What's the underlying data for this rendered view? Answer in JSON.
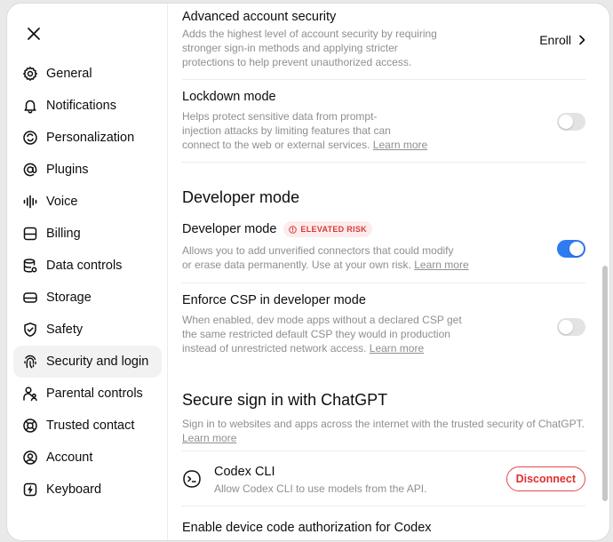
{
  "sidebar": {
    "items": [
      {
        "label": "General",
        "icon": "gear-icon"
      },
      {
        "label": "Notifications",
        "icon": "bell-icon"
      },
      {
        "label": "Personalization",
        "icon": "personalization-icon"
      },
      {
        "label": "Plugins",
        "icon": "at-icon"
      },
      {
        "label": "Voice",
        "icon": "waveform-icon"
      },
      {
        "label": "Billing",
        "icon": "billing-icon"
      },
      {
        "label": "Data controls",
        "icon": "database-icon"
      },
      {
        "label": "Storage",
        "icon": "storage-icon"
      },
      {
        "label": "Safety",
        "icon": "shield-icon"
      },
      {
        "label": "Security and login",
        "icon": "fingerprint-icon"
      },
      {
        "label": "Parental controls",
        "icon": "parental-icon"
      },
      {
        "label": "Trusted contact",
        "icon": "lifebuoy-icon"
      },
      {
        "label": "Account",
        "icon": "account-icon"
      },
      {
        "label": "Keyboard",
        "icon": "keyboard-icon"
      }
    ],
    "active": "Security and login"
  },
  "security": {
    "advanced": {
      "title": "Advanced account security",
      "desc_1": "Adds the highest level of account security by requiring",
      "desc_2": "stronger sign-in methods and applying stricter",
      "desc_3": "protections to help prevent unauthorized access.",
      "action": "Enroll"
    },
    "lockdown": {
      "title": "Lockdown mode",
      "desc_1": "Helps protect sensitive data from prompt-",
      "desc_2": "injection attacks by limiting features that can",
      "desc_3": "connect to the web or external services.",
      "link": "Learn more",
      "enabled": false
    }
  },
  "developer": {
    "section_title": "Developer mode",
    "mode": {
      "title": "Developer mode",
      "badge": "ELEVATED RISK",
      "desc_1": "Allows you to add unverified connectors that could modify",
      "desc_2": "or erase data permanently. Use at your own risk.",
      "link": "Learn more",
      "enabled": true
    },
    "csp": {
      "title": "Enforce CSP in developer mode",
      "desc_1": "When enabled, dev mode apps without a declared CSP get",
      "desc_2": "the same restricted default CSP they would in production",
      "desc_3": "instead of unrestricted network access.",
      "link": "Learn more",
      "enabled": false
    }
  },
  "signin": {
    "section_title": "Secure sign in with ChatGPT",
    "desc": "Sign in to websites and apps across the internet with the trusted security of ChatGPT.",
    "link": "Learn more",
    "codex": {
      "title": "Codex CLI",
      "desc": "Allow Codex CLI to use models from the API.",
      "action": "Disconnect"
    },
    "next_partial": "Enable device code authorization for Codex"
  },
  "colors": {
    "accent": "#2f7bf0",
    "danger": "#e02e2e",
    "badge_bg": "#fdecec"
  }
}
